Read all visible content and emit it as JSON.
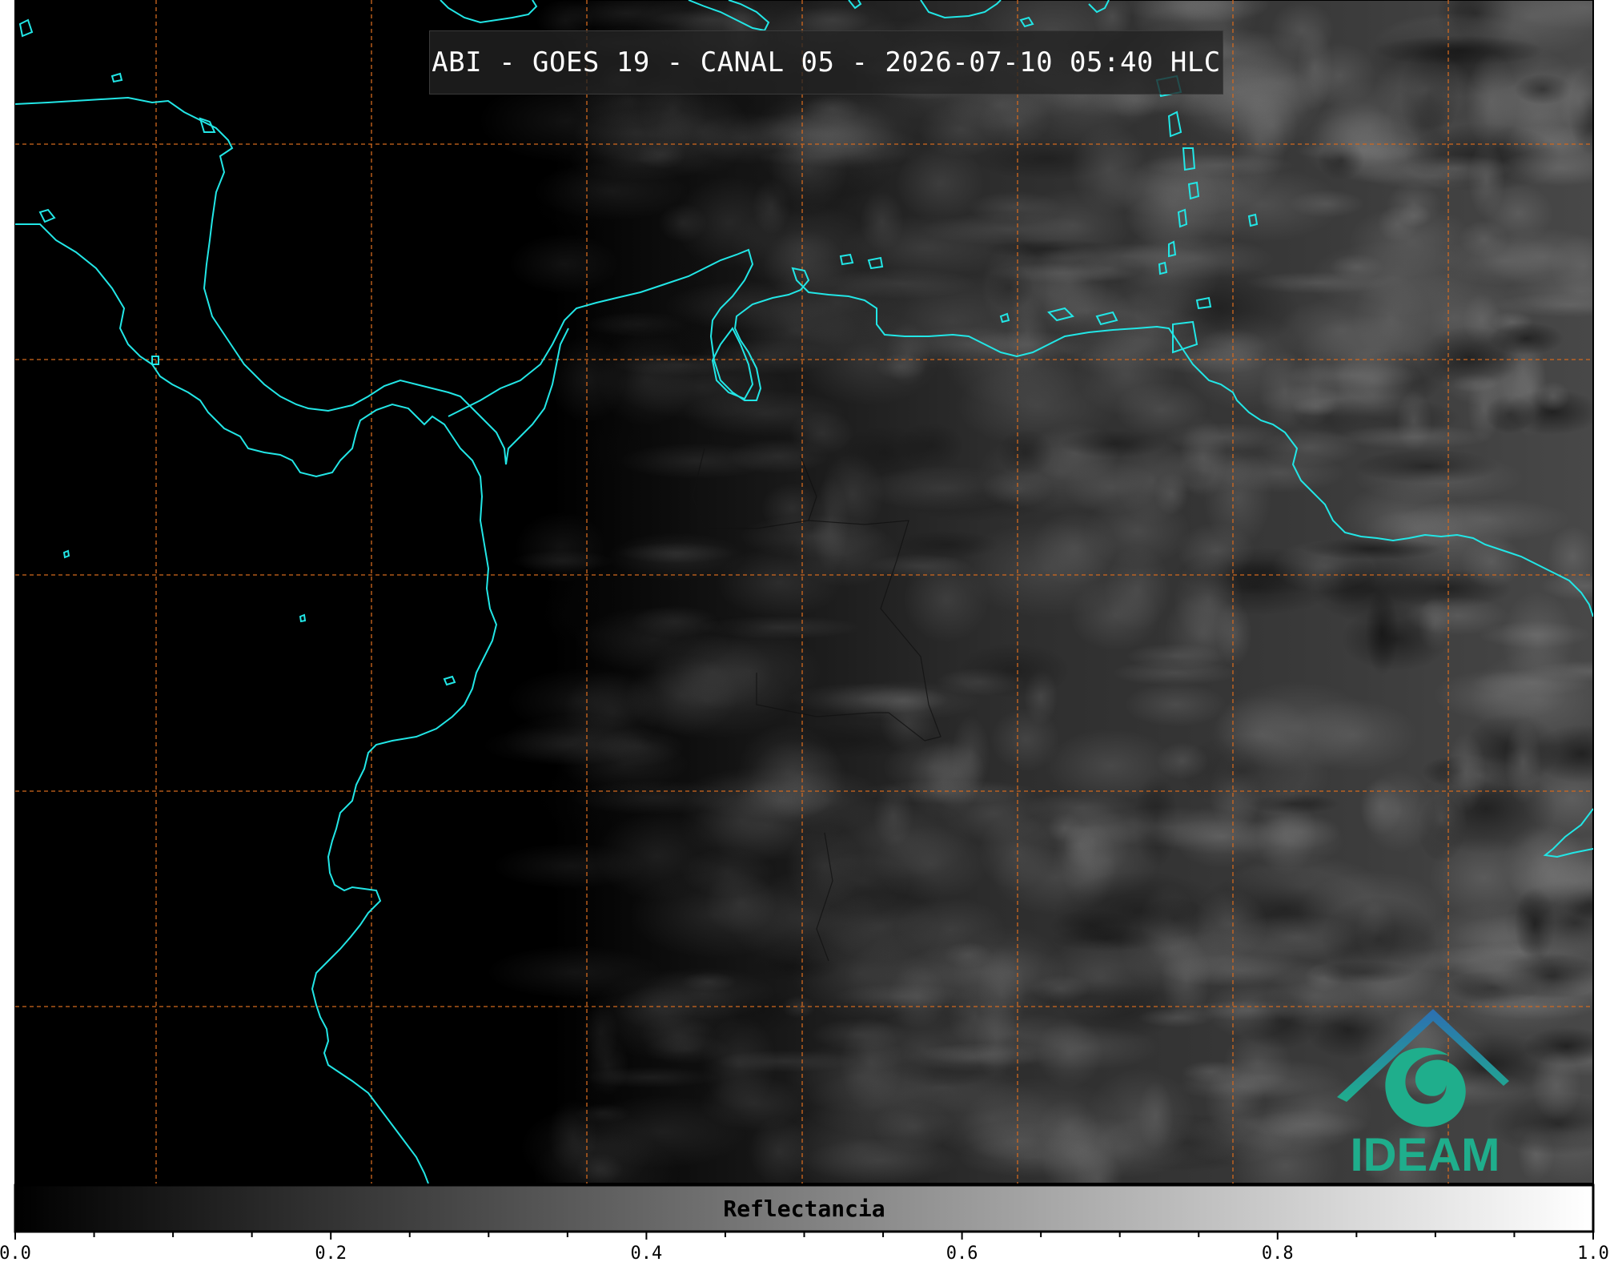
{
  "title": "ABI - GOES 19 - CANAL 05 - 2026-07-10 05:40 HLC",
  "logo": {
    "text": "IDEAM",
    "icon": "ideam-mountain-swirl-logo"
  },
  "colors": {
    "coastline": "#22e6e6",
    "grid": "#d2691e",
    "logo_blue": "#2d6fb2",
    "logo_green": "#1fae8c",
    "background": "#000000"
  },
  "colorbar": {
    "label": "Reflectancia",
    "range": [
      0.0,
      1.0
    ],
    "tick_labels": [
      "0.0",
      "0.2",
      "0.4",
      "0.6",
      "0.8",
      "1.0"
    ],
    "colormap": "grayscale black-to-white"
  },
  "map": {
    "gridlines": "dashed",
    "features": [
      "coastlines",
      "country borders",
      "graticule"
    ]
  }
}
